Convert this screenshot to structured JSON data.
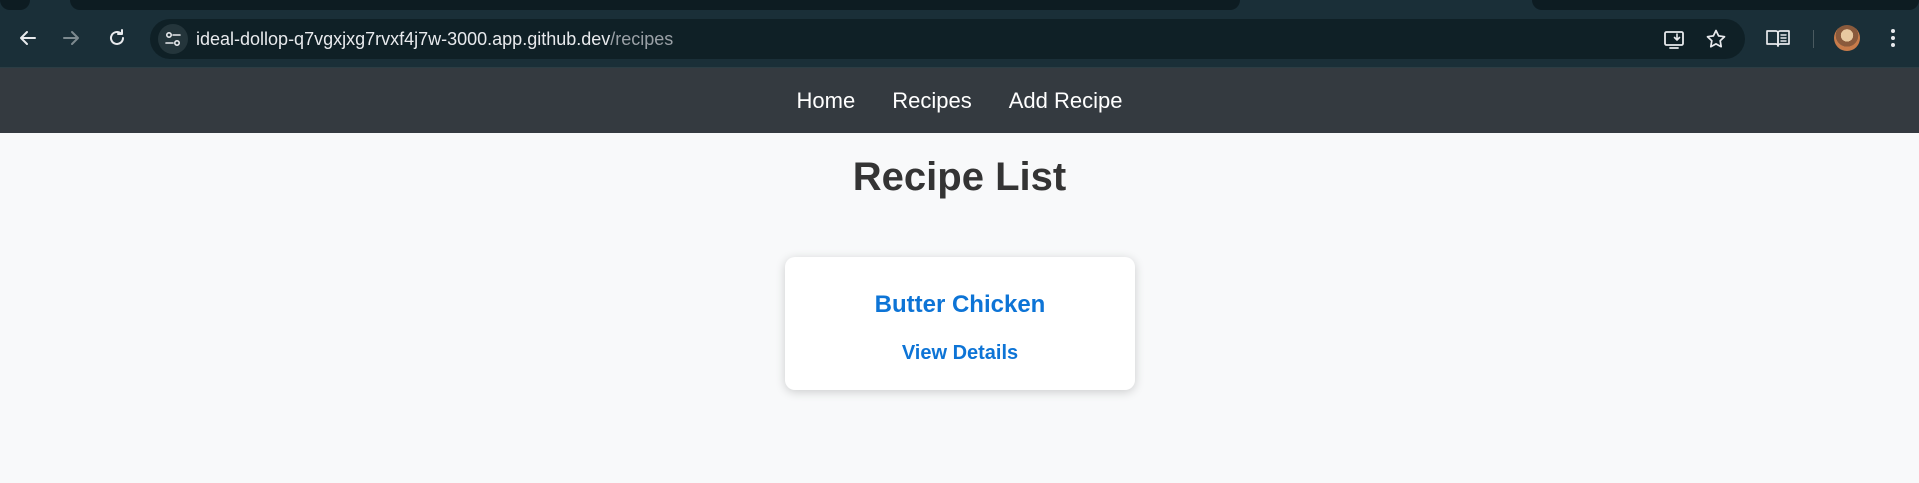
{
  "browser": {
    "url_host": "ideal-dollop-q7vgxjxg7rvxf4j7w-3000.app.github.dev",
    "url_path": "/recipes",
    "icons": [
      "back-icon",
      "forward-icon",
      "reload-icon",
      "site-info-icon",
      "install-app-icon",
      "bookmark-star-icon",
      "reading-mode-icon",
      "profile-avatar",
      "menu-kebab-icon"
    ],
    "colors": {
      "frame": "#1a2f38",
      "omnibox": "#0f2026"
    }
  },
  "site_nav": {
    "items": [
      {
        "label": "Home"
      },
      {
        "label": "Recipes"
      },
      {
        "label": "Add Recipe"
      }
    ],
    "background": "#343a40"
  },
  "main": {
    "title": "Recipe List",
    "recipes": [
      {
        "name": "Butter Chicken",
        "link_label": "View Details"
      }
    ],
    "accent": "#0d74d6"
  }
}
